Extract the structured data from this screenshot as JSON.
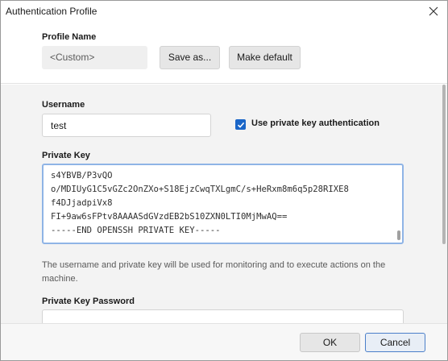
{
  "window": {
    "title": "Authentication Profile"
  },
  "profile": {
    "label": "Profile Name",
    "value": "<Custom>",
    "save_as_label": "Save as...",
    "make_default_label": "Make default"
  },
  "username": {
    "label": "Username",
    "value": "test"
  },
  "private_key_auth": {
    "label": "Use private key authentication",
    "checked": true
  },
  "private_key": {
    "label": "Private Key",
    "lines": [
      "s4YBVB/P3vQO",
      "o/MDIUyG1C5vGZc2OnZXo+S18EjzCwqTXLgmC/s+HeRxm8m6q5p28RIXE8",
      "f4DJjadpiVx8",
      "FI+9aw6sFPtv8AAAASdGVzdEB2bS10ZXN0LTI0MjMwAQ==",
      "-----END OPENSSH PRIVATE KEY-----"
    ]
  },
  "help_text": "The username and private key will be used for monitoring and to execute actions on the machine.",
  "private_key_password": {
    "label": "Private Key Password",
    "value": ""
  },
  "footer": {
    "ok_label": "OK",
    "cancel_label": "Cancel"
  },
  "colors": {
    "accent": "#1a66c8",
    "focus_border": "#8fb4e6",
    "content_bg": "#f3f3f3"
  },
  "icons": {
    "close": "close-icon",
    "checkbox": "checkmark-icon"
  }
}
